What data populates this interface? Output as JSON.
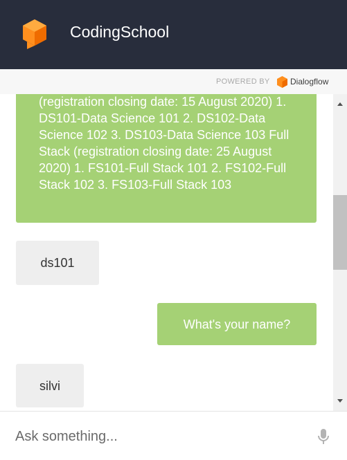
{
  "header": {
    "title": "CodingSchool"
  },
  "powered": {
    "label": "POWERED BY",
    "brand": "Dialogflow"
  },
  "messages": [
    {
      "role": "bot",
      "text": "(registration closing date: 15 August 2020) 1. DS101-Data Science 101 2. DS102-Data Science 102 3. DS103-Data Science 103 Full Stack (registration closing date: 25 August 2020) 1. FS101-Full Stack 101 2. FS102-Full Stack 102 3. FS103-Full Stack 103"
    },
    {
      "role": "user",
      "text": "ds101"
    },
    {
      "role": "bot",
      "text": "What's your name?"
    },
    {
      "role": "user",
      "text": "silvi"
    }
  ],
  "input": {
    "placeholder": "Ask something..."
  },
  "colors": {
    "header": "#282d3c",
    "bot_bubble": "#a5d175",
    "user_bubble": "#eeeeee",
    "logo": "#ff8f1e"
  },
  "icons": {
    "app_logo": "dialogflow-cube-logo",
    "mic": "microphone-icon"
  }
}
